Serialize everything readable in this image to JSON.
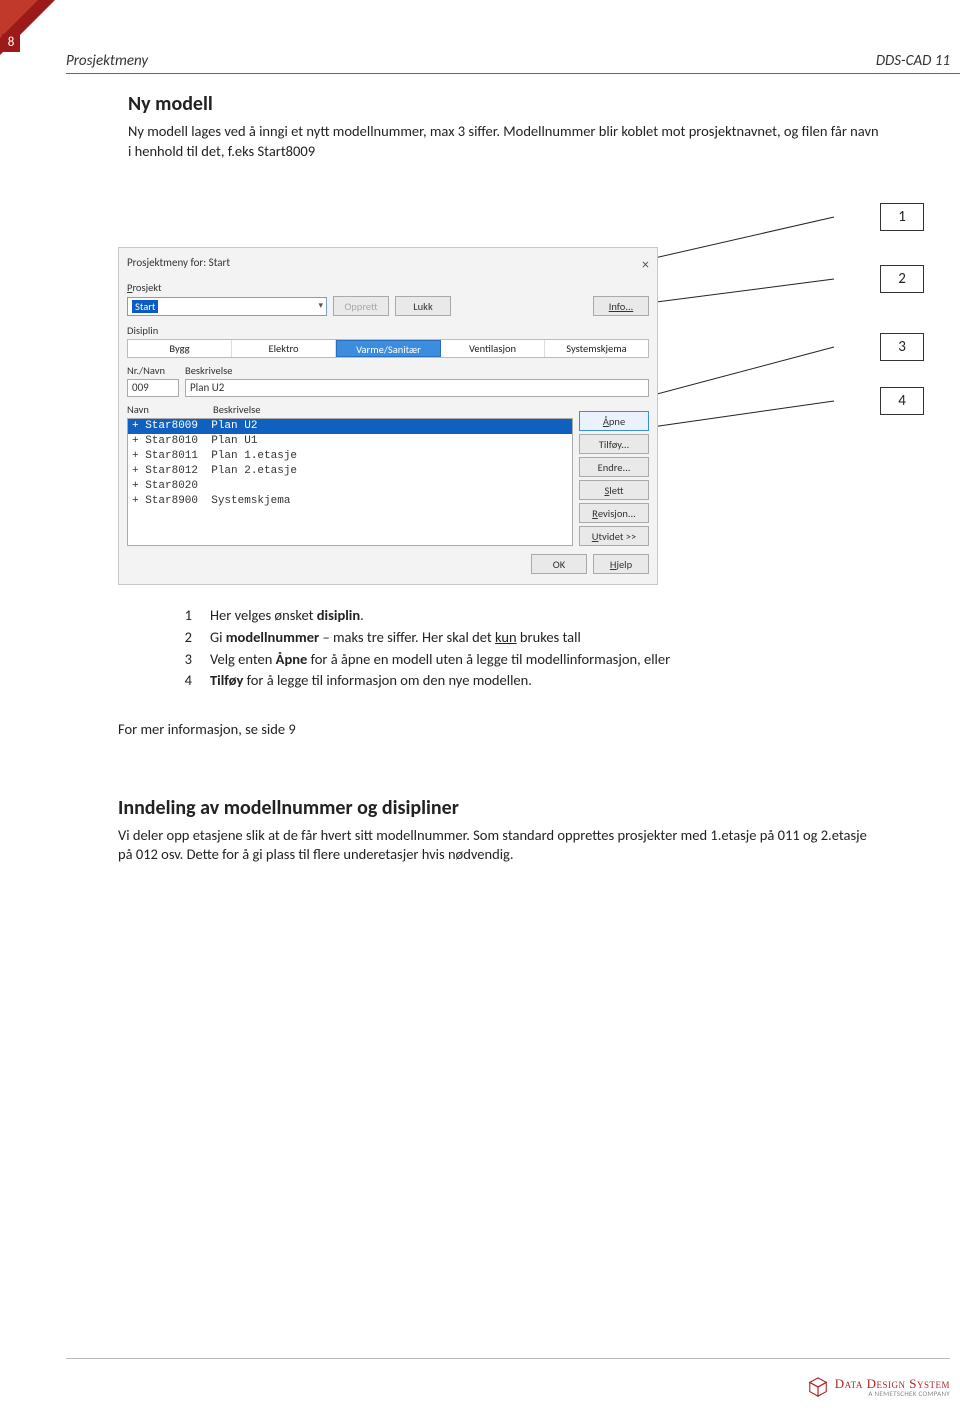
{
  "page_number": "8",
  "header": {
    "left": "Prosjektmeny",
    "right": "DDS-CAD 11"
  },
  "section1": {
    "title": "Ny modell",
    "para": "Ny modell lages ved å inngi et nytt modellnummer, max 3 siffer. Modellnummer blir koblet mot prosjektnavnet, og filen får navn i henhold til det, f.eks Start8009"
  },
  "dialog": {
    "title": "Prosjektmeny for: Start",
    "prosjekt_label": "Prosjekt",
    "prosjekt_value": "Start",
    "btn_opprett": "Opprett",
    "btn_lukk": "Lukk",
    "btn_info": "Info...",
    "disiplin_label": "Disiplin",
    "tabs": [
      "Bygg",
      "Elektro",
      "Varme/Sanitær",
      "Ventilasjon",
      "Systemskjema"
    ],
    "nrnavn_label": "Nr./Navn",
    "beskriv_label": "Beskrivelse",
    "nr_value": "009",
    "beskriv_value": "Plan U2",
    "list_header_navn": "Navn",
    "list_header_beskriv": "Beskrivelse",
    "rows": [
      {
        "t": "+ Star8009  Plan U2",
        "sel": true
      },
      {
        "t": "+ Star8010  Plan U1",
        "sel": false
      },
      {
        "t": "+ Star8011  Plan 1.etasje",
        "sel": false
      },
      {
        "t": "+ Star8012  Plan 2.etasje",
        "sel": false
      },
      {
        "t": "+ Star8020",
        "sel": false
      },
      {
        "t": "+ Star8900  Systemskjema",
        "sel": false
      }
    ],
    "side": {
      "apne": "Åpne",
      "tilfoy": "Tilføy...",
      "endre": "Endre...",
      "slett": "Slett",
      "revisjon": "Revisjon...",
      "utvidet": "Utvidet >>"
    },
    "btn_ok": "OK",
    "btn_help": "Hjelp"
  },
  "callouts": {
    "c1": "1",
    "c2": "2",
    "c3": "3",
    "c4": "4"
  },
  "legend": {
    "n1": "1",
    "t1a": "Her velges ønsket ",
    "t1b": "disiplin",
    "t1c": ".",
    "n2": "2",
    "t2a": "Gi ",
    "t2b": "modellnummer",
    "t2c": " – maks tre siffer. Her skal det ",
    "t2d": "kun",
    "t2e": " brukes tall",
    "n3": "3",
    "t3a": "Velg enten ",
    "t3b": "Åpne",
    "t3c": " for å åpne en modell uten å legge til modellinformasjon, eller",
    "n4": "4",
    "t4a": "Tilføy",
    "t4b": " for å legge til informasjon om den nye modellen."
  },
  "more_info": "For mer informasjon, se side 9",
  "section2": {
    "title": "Inndeling av modellnummer og disipliner",
    "para": "Vi deler opp etasjene slik at de får hvert sitt modellnummer. Som standard opprettes prosjekter med 1.etasje på 011 og 2.etasje på 012 osv. Dette for å gi plass til flere underetasjer hvis nødvendig."
  },
  "footer": {
    "company": "Data Design System",
    "tagline": "A NEMETSCHEK COMPANY"
  }
}
